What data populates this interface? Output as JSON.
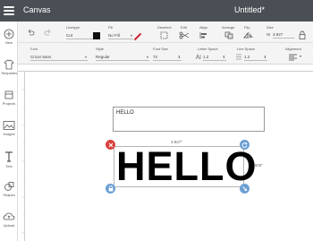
{
  "titlebar": {
    "app_title": "Canvas",
    "doc_title": "Untitled*"
  },
  "sidebar": {
    "items": [
      {
        "label": "New",
        "icon": "plus-icon"
      },
      {
        "label": "Templates",
        "icon": "shirt-icon"
      },
      {
        "label": "Projects",
        "icon": "projects-icon"
      },
      {
        "label": "Images",
        "icon": "image-icon"
      },
      {
        "label": "Text",
        "icon": "text-icon"
      },
      {
        "label": "Shapes",
        "icon": "shapes-icon"
      },
      {
        "label": "Upload",
        "icon": "cloud-icon"
      }
    ]
  },
  "toolbar1": {
    "linetype_label": "Linetype",
    "linetype_value": "Cut",
    "fill_label": "Fill",
    "fill_value": "No Fill",
    "deselect_label": "Deselect",
    "edit_label": "Edit",
    "align_label": "Align",
    "arrange_label": "Arrange",
    "flip_label": "Flip",
    "size_label": "Size",
    "size_w_label": "W",
    "size_value": "3.927",
    "line_color": "#111111"
  },
  "toolbar2": {
    "font_label": "Font",
    "font_value": "Cricut Sans",
    "style_label": "Style",
    "style_value": "Regular",
    "fontsize_label": "Font Size",
    "fontsize_value": "72",
    "letterspace_label": "Letter Space",
    "letterspace_value": "1.2",
    "linespace_label": "Line Space",
    "linespace_value": "1.2",
    "alignment_label": "Alignment"
  },
  "canvas": {
    "text_input": "HELLO",
    "display_text": "HELLO",
    "width_dim": "3.927\"",
    "height_dim": "1.005\""
  },
  "colors": {
    "titlebar": "#4a4f55",
    "delete_handle": "#d9423f",
    "blue_handle": "#6b9fd3",
    "pen_red": "#cc1f2f"
  }
}
